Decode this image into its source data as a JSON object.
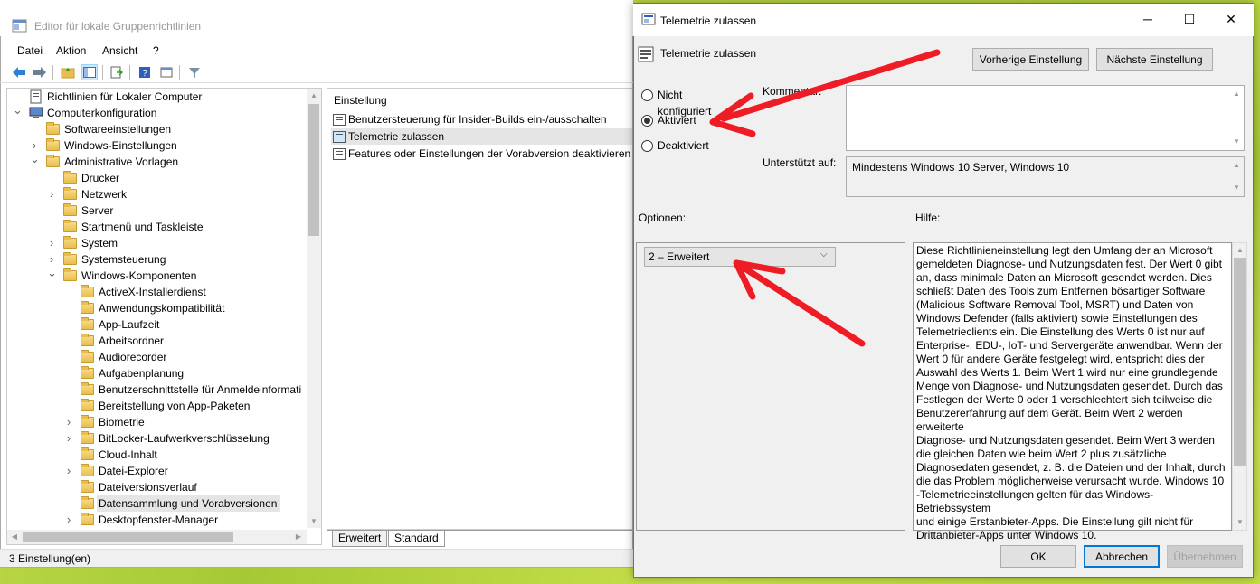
{
  "gpedit": {
    "title": "Editor für lokale Gruppenrichtlinien",
    "menu": [
      "Datei",
      "Aktion",
      "Ansicht",
      "?"
    ],
    "tree": [
      {
        "label": "Richtlinien für Lokaler Computer",
        "level": 0,
        "expander": "",
        "icon": "policy-icon"
      },
      {
        "label": "Computerkonfiguration",
        "level": 0,
        "expander": "open",
        "icon": "computer-icon"
      },
      {
        "label": "Softwareeinstellungen",
        "level": 1,
        "expander": "",
        "icon": "folder-icon"
      },
      {
        "label": "Windows-Einstellungen",
        "level": 1,
        "expander": "closed",
        "icon": "folder-icon"
      },
      {
        "label": "Administrative Vorlagen",
        "level": 1,
        "expander": "open",
        "icon": "folder-icon"
      },
      {
        "label": "Drucker",
        "level": 2,
        "expander": "",
        "icon": "folder-icon"
      },
      {
        "label": "Netzwerk",
        "level": 2,
        "expander": "closed",
        "icon": "folder-icon"
      },
      {
        "label": "Server",
        "level": 2,
        "expander": "",
        "icon": "folder-icon"
      },
      {
        "label": "Startmenü und Taskleiste",
        "level": 2,
        "expander": "",
        "icon": "folder-icon"
      },
      {
        "label": "System",
        "level": 2,
        "expander": "closed",
        "icon": "folder-icon"
      },
      {
        "label": "Systemsteuerung",
        "level": 2,
        "expander": "closed",
        "icon": "folder-icon"
      },
      {
        "label": "Windows-Komponenten",
        "level": 2,
        "expander": "open",
        "icon": "folder-icon"
      },
      {
        "label": "ActiveX-Installerdienst",
        "level": 3,
        "expander": "",
        "icon": "folder-icon"
      },
      {
        "label": "Anwendungskompatibilität",
        "level": 3,
        "expander": "",
        "icon": "folder-icon"
      },
      {
        "label": "App-Laufzeit",
        "level": 3,
        "expander": "",
        "icon": "folder-icon"
      },
      {
        "label": "Arbeitsordner",
        "level": 3,
        "expander": "",
        "icon": "folder-icon"
      },
      {
        "label": "Audiorecorder",
        "level": 3,
        "expander": "",
        "icon": "folder-icon"
      },
      {
        "label": "Aufgabenplanung",
        "level": 3,
        "expander": "",
        "icon": "folder-icon"
      },
      {
        "label": "Benutzerschnittstelle für Anmeldeinformati",
        "level": 3,
        "expander": "",
        "icon": "folder-icon"
      },
      {
        "label": "Bereitstellung von App-Paketen",
        "level": 3,
        "expander": "",
        "icon": "folder-icon"
      },
      {
        "label": "Biometrie",
        "level": 3,
        "expander": "closed",
        "icon": "folder-icon"
      },
      {
        "label": "BitLocker-Laufwerkverschlüsselung",
        "level": 3,
        "expander": "closed",
        "icon": "folder-icon"
      },
      {
        "label": "Cloud-Inhalt",
        "level": 3,
        "expander": "",
        "icon": "folder-icon"
      },
      {
        "label": "Datei-Explorer",
        "level": 3,
        "expander": "closed",
        "icon": "folder-icon"
      },
      {
        "label": "Dateiversionsverlauf",
        "level": 3,
        "expander": "",
        "icon": "folder-icon"
      },
      {
        "label": "Datensammlung und Vorabversionen",
        "level": 3,
        "expander": "",
        "icon": "folder-icon",
        "selected": true
      },
      {
        "label": "Desktopfenster-Manager",
        "level": 3,
        "expander": "closed",
        "icon": "folder-icon"
      }
    ],
    "list_header": "Einstellung",
    "list": [
      {
        "label": "Benutzersteuerung für Insider-Builds ein-/ausschalten",
        "selected": false
      },
      {
        "label": "Telemetrie zulassen",
        "selected": true
      },
      {
        "label": "Features oder Einstellungen der Vorabversion deaktivieren",
        "selected": false
      }
    ],
    "tabs": [
      "Erweitert",
      "Standard"
    ],
    "status": "3 Einstellung(en)"
  },
  "dialog": {
    "title": "Telemetrie zulassen",
    "heading": "Telemetrie zulassen",
    "prev_button": "Vorherige Einstellung",
    "next_button": "Nächste Einstellung",
    "radio_options": [
      {
        "label": "Nicht konfiguriert",
        "checked": false
      },
      {
        "label": "Aktiviert",
        "checked": true
      },
      {
        "label": "Deaktiviert",
        "checked": false
      }
    ],
    "comment_label": "Kommentar:",
    "supported_label": "Unterstützt auf:",
    "supported_value": "Mindestens Windows 10 Server, Windows 10",
    "options_label": "Optionen:",
    "help_label": "Hilfe:",
    "combo_value": "2 – Erweitert",
    "help_text": "Diese Richtlinieneinstellung legt den Umfang der an Microsoft\ngemeldeten Diagnose- und Nutzungsdaten fest. Der Wert 0 gibt\nan, dass minimale Daten an Microsoft gesendet werden. Dies\nschließt Daten des Tools zum Entfernen bösartiger Software\n(Malicious Software Removal Tool, MSRT) und Daten von\nWindows Defender (falls aktiviert) sowie Einstellungen des\nTelemetrieclients ein. Die Einstellung des Werts 0 ist nur auf\nEnterprise-, EDU-, IoT- und Servergeräte anwendbar. Wenn der\nWert 0 für andere Geräte festgelegt wird, entspricht dies der\nAuswahl des Werts 1. Beim Wert 1 wird nur eine grundlegende\nMenge von Diagnose- und Nutzungsdaten gesendet. Durch das\nFestlegen der Werte 0 oder 1 verschlechtert sich teilweise die\nBenutzererfahrung auf dem Gerät. Beim Wert 2 werden erweiterte\nDiagnose- und Nutzungsdaten gesendet. Beim Wert 3 werden\ndie gleichen Daten wie beim Wert 2 plus zusätzliche\nDiagnosedaten gesendet, z. B. die Dateien und der Inhalt, durch\ndie das Problem möglicherweise verursacht wurde. Windows 10\n-Telemetrieeinstellungen gelten für das Windows-Betriebssystem\nund einige Erstanbieter-Apps. Die Einstellung gilt nicht für\nDrittanbieter-Apps unter Windows 10.",
    "ok_button": "OK",
    "cancel_button": "Abbrechen",
    "apply_button": "Übernehmen"
  },
  "colors": {
    "accent": "#0078d7",
    "annotation": "#ee1c24",
    "selection": "#cce8ff"
  }
}
